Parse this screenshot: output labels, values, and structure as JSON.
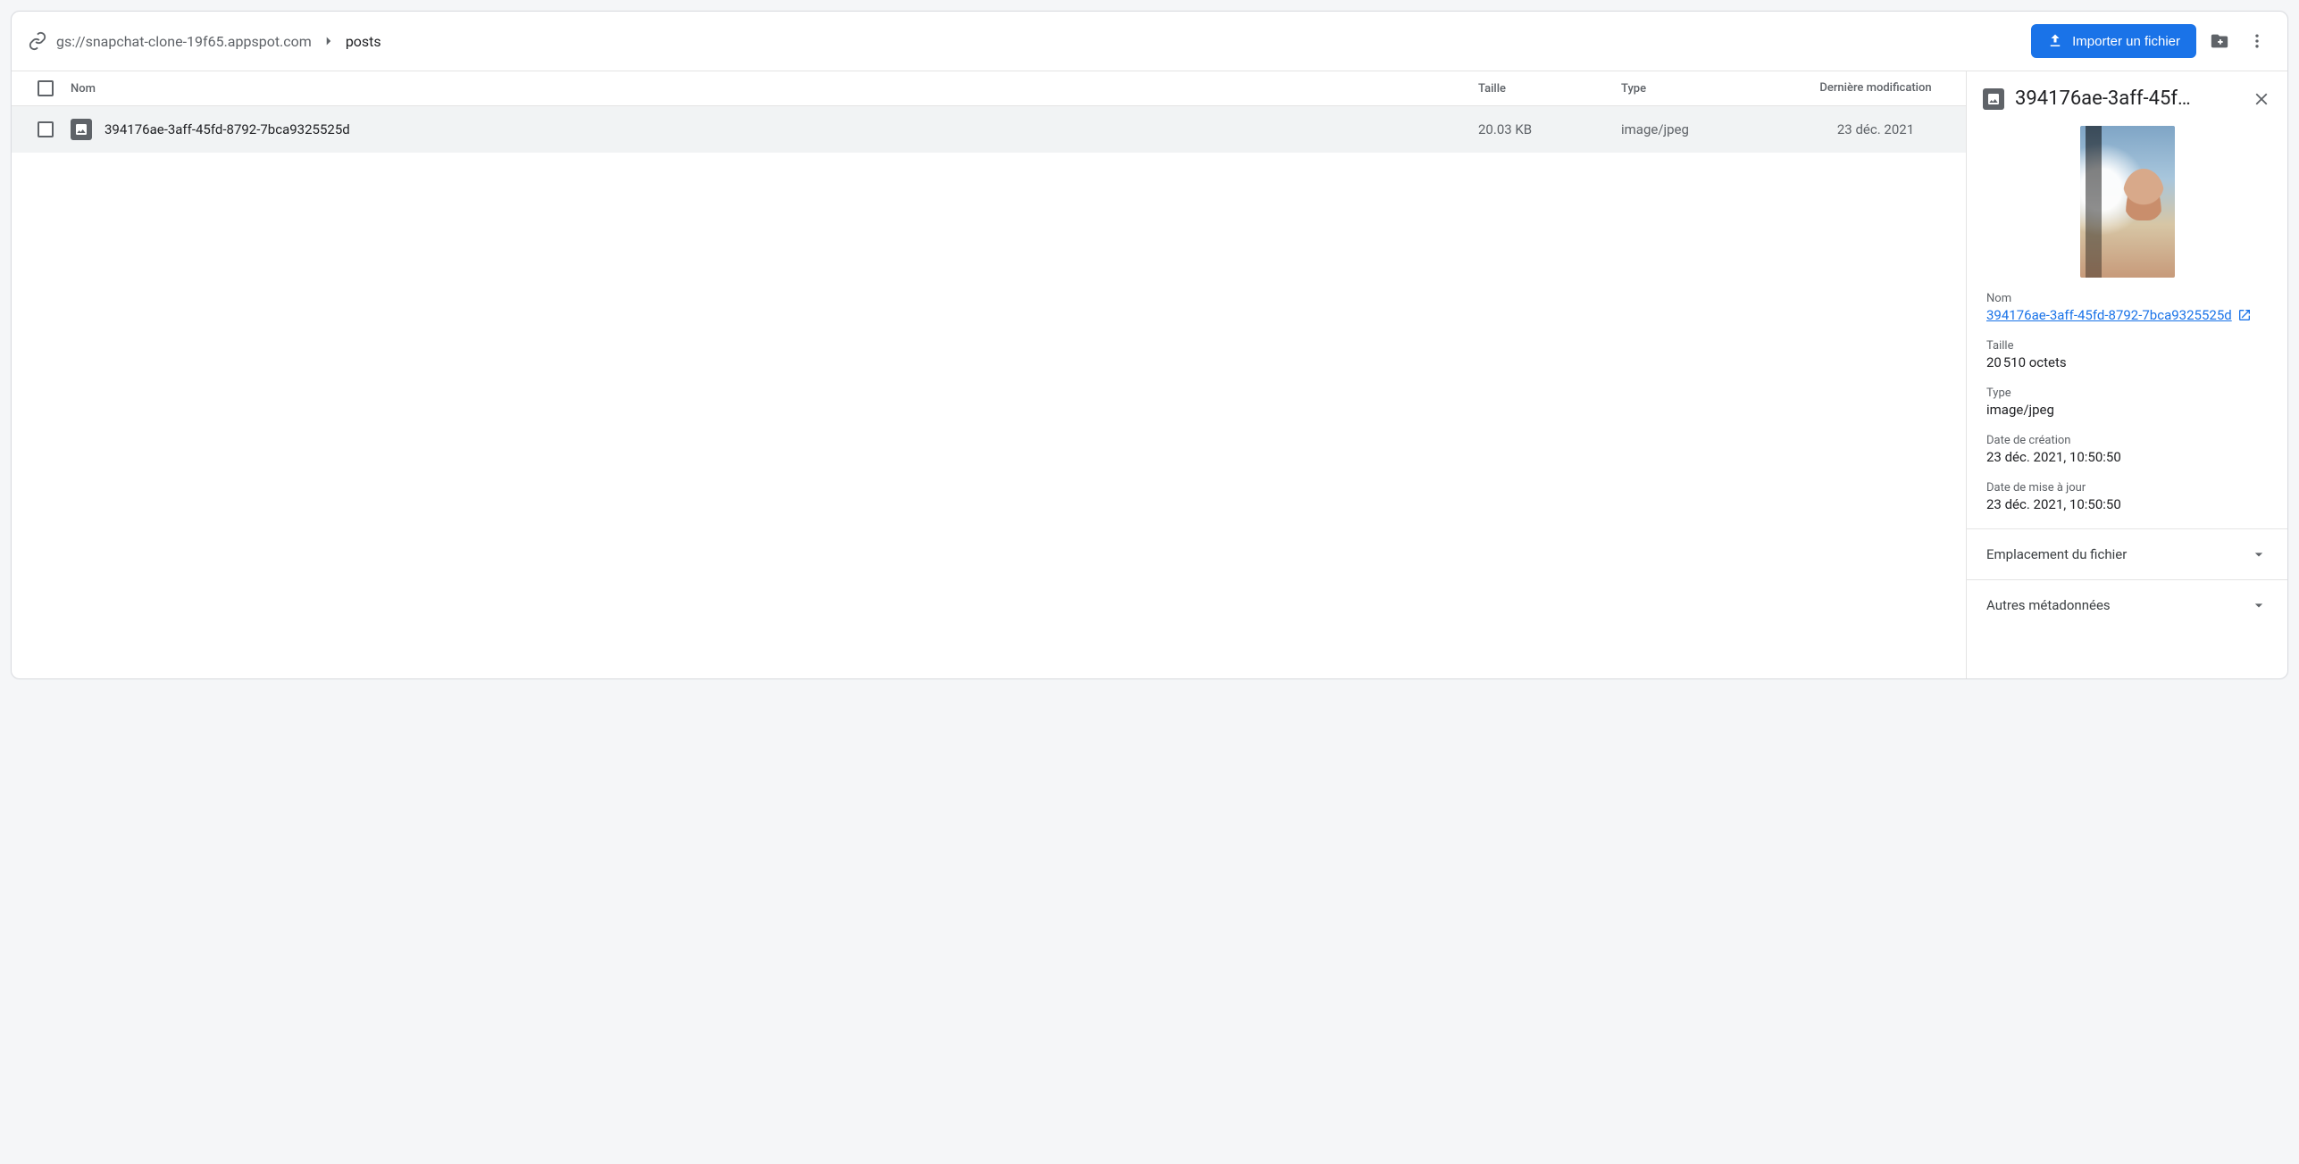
{
  "breadcrumb": {
    "root": "gs://snapchat-clone-19f65.appspot.com",
    "current": "posts"
  },
  "toolbar": {
    "import_label": "Importer un fichier"
  },
  "table": {
    "headers": {
      "name": "Nom",
      "size": "Taille",
      "type": "Type",
      "modified": "Dernière modification"
    },
    "rows": [
      {
        "name": "394176ae-3aff-45fd-8792-7bca9325525d",
        "size": "20.03 KB",
        "type": "image/jpeg",
        "modified": "23 déc. 2021"
      }
    ]
  },
  "details": {
    "title": "394176ae-3aff-45f…",
    "name_label": "Nom",
    "name_value": "394176ae-3aff-45fd-8792-7bca9325525d",
    "size_label": "Taille",
    "size_value": "20 510 octets",
    "type_label": "Type",
    "type_value": "image/jpeg",
    "created_label": "Date de création",
    "created_value": "23 déc. 2021, 10:50:50",
    "updated_label": "Date de mise à jour",
    "updated_value": "23 déc. 2021, 10:50:50",
    "accordion_location": "Emplacement du fichier",
    "accordion_other": "Autres métadonnées"
  }
}
